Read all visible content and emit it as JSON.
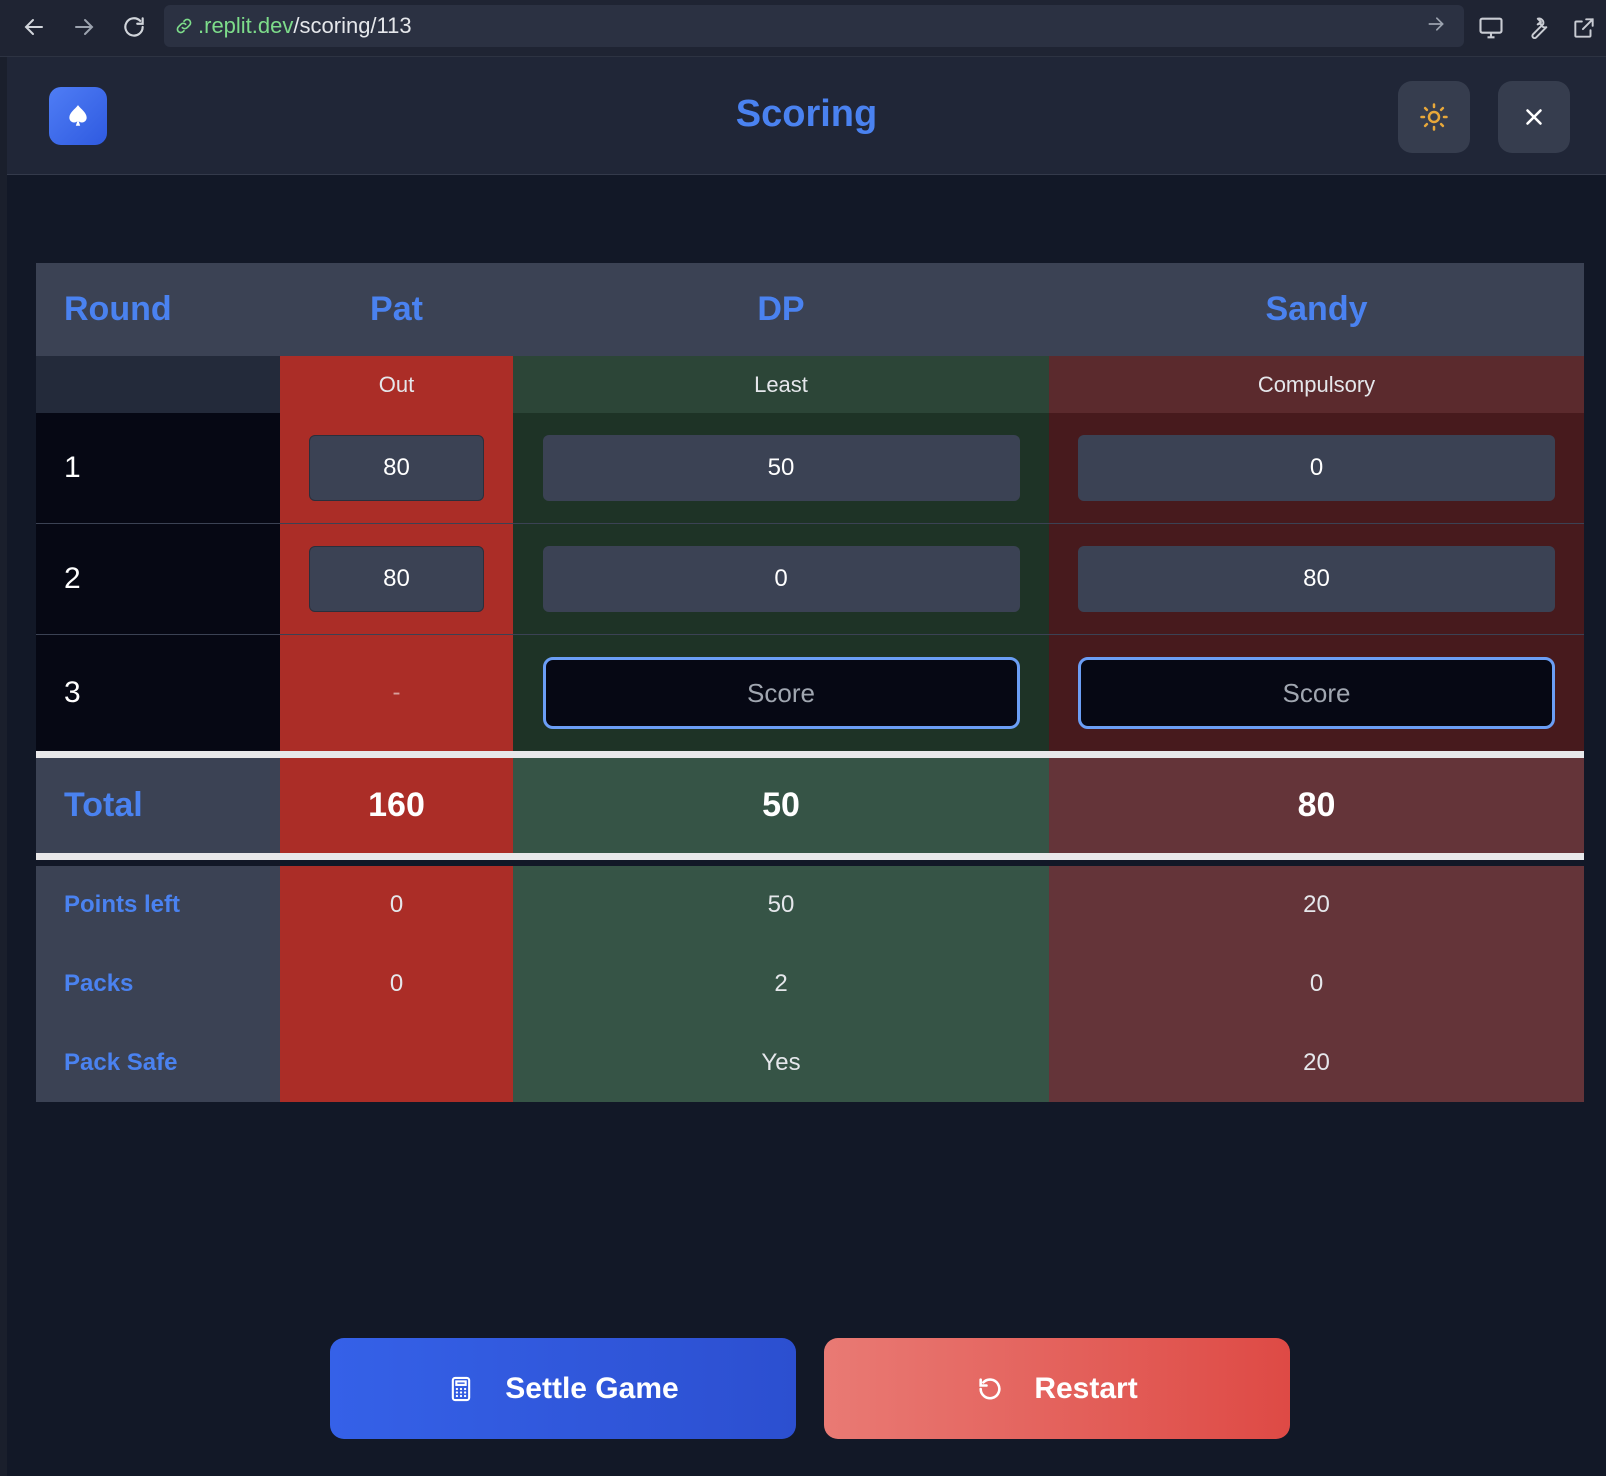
{
  "browser": {
    "url_domain": ".replit.dev",
    "url_path": "/scoring/113"
  },
  "header": {
    "title": "Scoring",
    "logo_icon": "spade-icon",
    "theme_icon": "sun-icon",
    "close_icon": "close-icon"
  },
  "table": {
    "head": [
      "Round",
      "Pat",
      "DP",
      "Sandy"
    ],
    "statuses": [
      "Out",
      "Least",
      "Compulsory"
    ],
    "rounds": [
      {
        "label": "1",
        "scores": [
          "80",
          "50",
          "0"
        ]
      },
      {
        "label": "2",
        "scores": [
          "80",
          "0",
          "80"
        ]
      },
      {
        "label": "3",
        "pat": "-",
        "placeholder": "Score"
      }
    ],
    "total": {
      "label": "Total",
      "values": [
        "160",
        "50",
        "80"
      ]
    },
    "stats": [
      {
        "label": "Points left",
        "values": [
          "0",
          "50",
          "20"
        ]
      },
      {
        "label": "Packs",
        "values": [
          "0",
          "2",
          "0"
        ]
      },
      {
        "label": "Pack Safe",
        "values": [
          "",
          "Yes",
          "20"
        ]
      }
    ]
  },
  "actions": {
    "settle_label": "Settle Game",
    "restart_label": "Restart"
  },
  "colors": {
    "accent": "#4a82f0",
    "out": "#ab2d27",
    "least": "#2c4537",
    "compulsory": "#5b2a2d"
  }
}
